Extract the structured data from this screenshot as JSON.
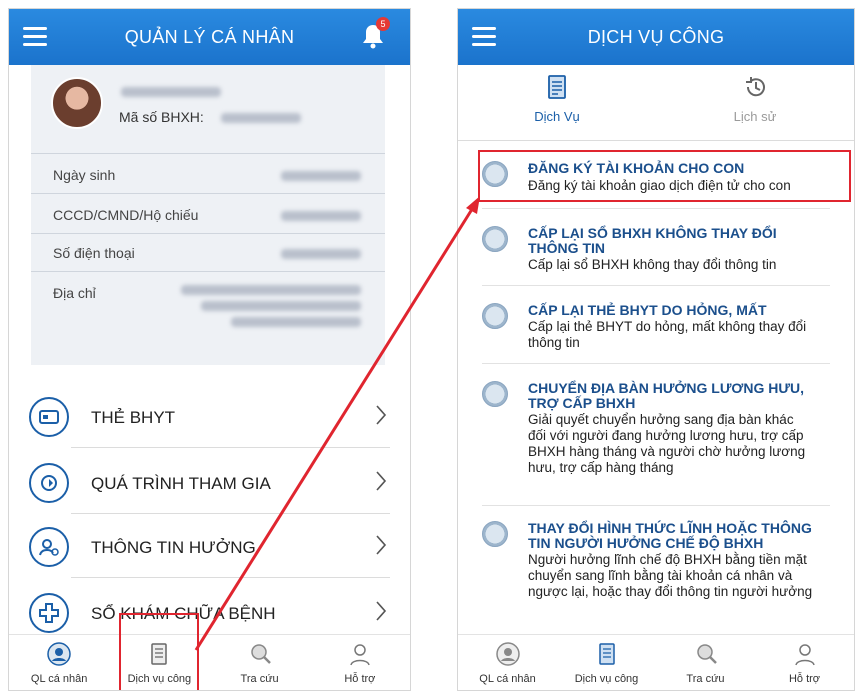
{
  "left": {
    "header_title": "QUẢN LÝ CÁ NHÂN",
    "notification_count": "5",
    "profile": {
      "ma_so_label": "Mã số BHXH:",
      "fields": [
        "Ngày sinh",
        "CCCD/CMND/Hộ chiếu",
        "Số điện thoại",
        "Địa chỉ"
      ]
    },
    "menu": [
      "THẺ BHYT",
      "QUÁ TRÌNH THAM GIA",
      "THÔNG TIN HƯỞNG",
      "SỔ KHÁM CHỮA BỆNH"
    ]
  },
  "right": {
    "header_title": "DỊCH VỤ CÔNG",
    "tabs": [
      "Dịch Vụ",
      "Lịch sử"
    ],
    "services": [
      {
        "title": [
          "ĐĂNG KÝ TÀI KHOẢN CHO CON"
        ],
        "desc": [
          "Đăng ký tài khoản giao dịch điện tử cho con"
        ]
      },
      {
        "title": [
          "CẤP LẠI SỔ BHXH KHÔNG THAY ĐỔI",
          "THÔNG TIN"
        ],
        "desc": [
          "Cấp lại sổ BHXH không thay đổi thông tin"
        ]
      },
      {
        "title": [
          "CẤP LẠI THẺ BHYT DO HỎNG, MẤT"
        ],
        "desc": [
          "Cấp lại thẻ BHYT do hỏng, mất không thay đổi",
          "thông tin"
        ]
      },
      {
        "title": [
          "CHUYỂN ĐỊA BÀN HƯỞNG LƯƠNG HƯU,",
          "TRỢ CẤP BHXH"
        ],
        "desc": [
          "Giải quyết chuyển hưởng sang địa bàn khác",
          "đối với người đang hưởng lương hưu, trợ cấp",
          "BHXH hàng tháng và người chờ hưởng lương",
          "hưu, trợ cấp hàng tháng"
        ]
      },
      {
        "title": [
          "THAY ĐỔI HÌNH THỨC LĨNH HOẶC THÔNG",
          "TIN NGƯỜI HƯỞNG CHẾ ĐỘ BHXH"
        ],
        "desc": [
          "Người hưởng lĩnh chế độ BHXH bằng tiền mặt",
          "chuyển sang lĩnh bằng tài khoản cá nhân và",
          "ngược lại, hoặc thay đổi thông tin người hưởng"
        ]
      }
    ]
  },
  "bottom_nav": [
    "QL cá nhân",
    "Dịch vụ công",
    "Tra cứu",
    "Hỗ trợ"
  ],
  "colors": {
    "header": "#1b73cc",
    "accent": "#1b5fa8",
    "highlight": "#e0252f"
  }
}
